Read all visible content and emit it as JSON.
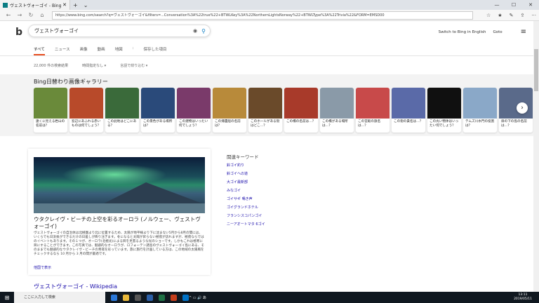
{
  "browser": {
    "tab_title": "ヴェストヴォーゴイ - Bing",
    "url": "https://www.bing.com/search?q=ヴェストヴォーゴイ&filters=...Conversation%3A%22true%22+BTWLKey%3A%22NorthernLightsNorway%22+BTWLType%3A%22Trivia%22&FORM=EMSD00"
  },
  "bing": {
    "query": "ヴェストヴォーゴイ",
    "switch_lang": "Switch to Bing in English",
    "user": "Goto",
    "scopes": [
      "すべて",
      "ニュース",
      "画像",
      "動画",
      "地図",
      ":",
      "保存した項目"
    ],
    "result_count": "22,000 件の検索結果",
    "date_filter": "時間指定なし ▾",
    "lang_filter": "言語で絞り込む ▾"
  },
  "gallery": {
    "title": "Bing日替わり画像ギャラリー",
    "cards": [
      {
        "cap": "遠くに見える岩山の名前は？",
        "color": "#6a8a3a"
      },
      {
        "cap": "窓辺にあふれる赤いものは何でしょう？",
        "color": "#b84a2a"
      },
      {
        "cap": "この此地はどこにある？",
        "color": "#3a6a3a"
      },
      {
        "cap": "この景色がある場所は？",
        "color": "#2a4a7a"
      },
      {
        "cap": "この建物はいったい何でしょう？",
        "color": "#7a3a6a"
      },
      {
        "cap": "この帰還船の名前は？",
        "color": "#b88a3a"
      },
      {
        "cap": "このホールがある街はどこ…？",
        "color": "#6a4a2a"
      },
      {
        "cap": "この橋の名前は…？",
        "color": "#a83a2a"
      },
      {
        "cap": "この橋がある場所は…？",
        "color": "#8a9aa8"
      },
      {
        "cap": "この宮殿の旗名は…？",
        "color": "#c84a4a"
      },
      {
        "cap": "この街の貴名は…？",
        "color": "#5a6aa8"
      },
      {
        "cap": "この丸い物体はいったい何でしょう？",
        "color": "#101010"
      },
      {
        "cap": "テムズ川水門の役割は？",
        "color": "#8aa8c8"
      },
      {
        "cap": "扉の下の島の名前は…？",
        "color": "#5a6a8a"
      }
    ]
  },
  "main": {
    "title": "ウタクレイヴ・ビーチの上空を彩るオーロラ (ノルウェー、ヴェストヴォーゴイ)",
    "body": "ヴェストヴォーゴイの自治体は北極圏より北に位置するため、太陽が地平線より下に沈まない5月から8月の間には、いくらでも日没後ができるだけの日差しが降り注ぎます。冬になると太陽が昇らない極夜が訪れますが、極夜ならではのイベントもあります。その１つが、オーロラ(北極光)による目を見張るような光のショーです。しかもこれは極寒に目にすることができます。この写真では、魅惑的なオーロラが、ロフォーテン諸島のヴェストヴォーゴイ島にある、そのままでも魅惑的なウタクレイヴ・ビーチの青夜を彩っています。旅に旅行を計画している方は、この地域の太陽風をチェックするなら 10 月から 3 月の間が最適です。",
    "more": "他国で表示"
  },
  "related": {
    "title": "関連キーワード",
    "items": [
      "鈴ゴイ釣り",
      "鈴ゴイへの道",
      "大ゴイ最新部",
      "みなゴイ",
      "ゴイサギ 鳴き声",
      "ゴイグランドホテル",
      "フランシスコパンゴイ",
      "ニーアオートマタ 6ゴイ"
    ]
  },
  "wiki_title": "ヴェストヴォーゴイ - Wikipedia",
  "taskbar": {
    "search": "ここに入力して検索",
    "time": "13:11",
    "date": "2019/05/11"
  }
}
